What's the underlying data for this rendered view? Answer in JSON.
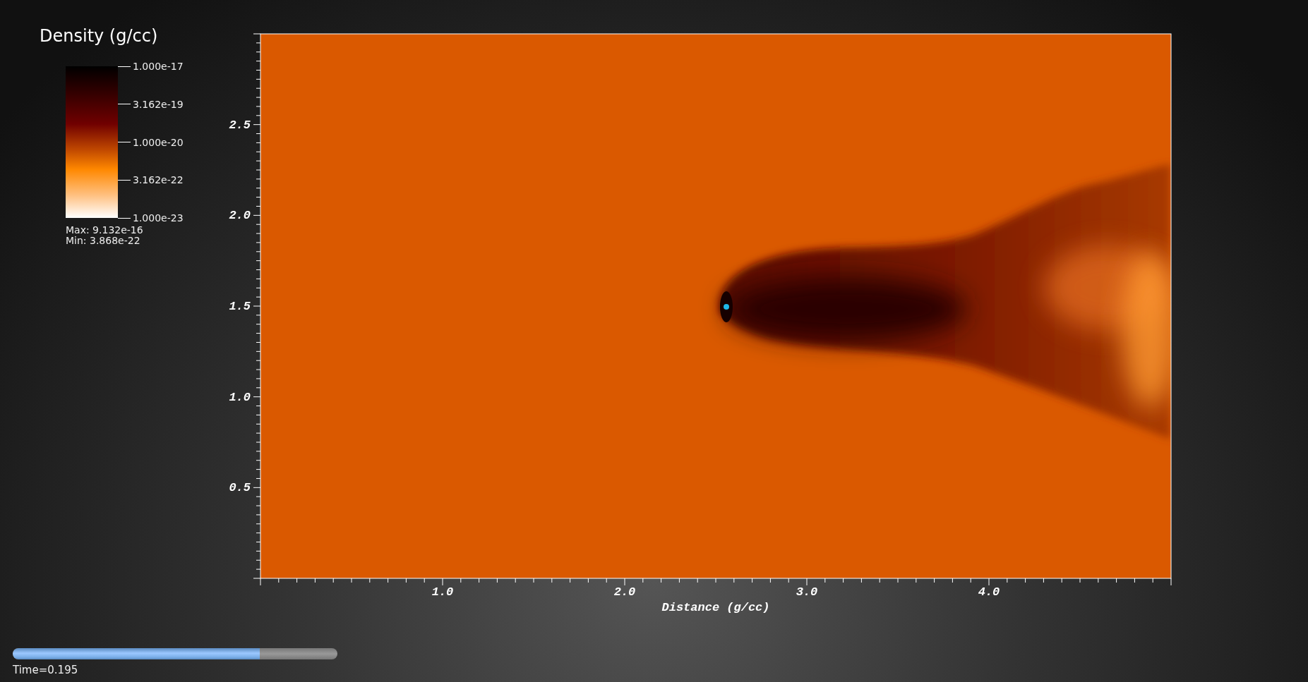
{
  "legend": {
    "title": "Density (g/cc)",
    "ticks": [
      "1.000e-17",
      "3.162e-19",
      "1.000e-20",
      "3.162e-22",
      "1.000e-23"
    ],
    "max_label": "Max:  9.132e-16",
    "min_label": "Min:  3.868e-22"
  },
  "plot": {
    "y_ticks": [
      "2.5",
      "2.0",
      "1.5",
      "1.0",
      "0.5"
    ],
    "x_ticks": [
      "1.0",
      "2.0",
      "3.0",
      "4.0"
    ],
    "xlabel": "Distance (g/cc)"
  },
  "time_slider": {
    "level": 0.76,
    "label": "Time=0.195"
  }
}
